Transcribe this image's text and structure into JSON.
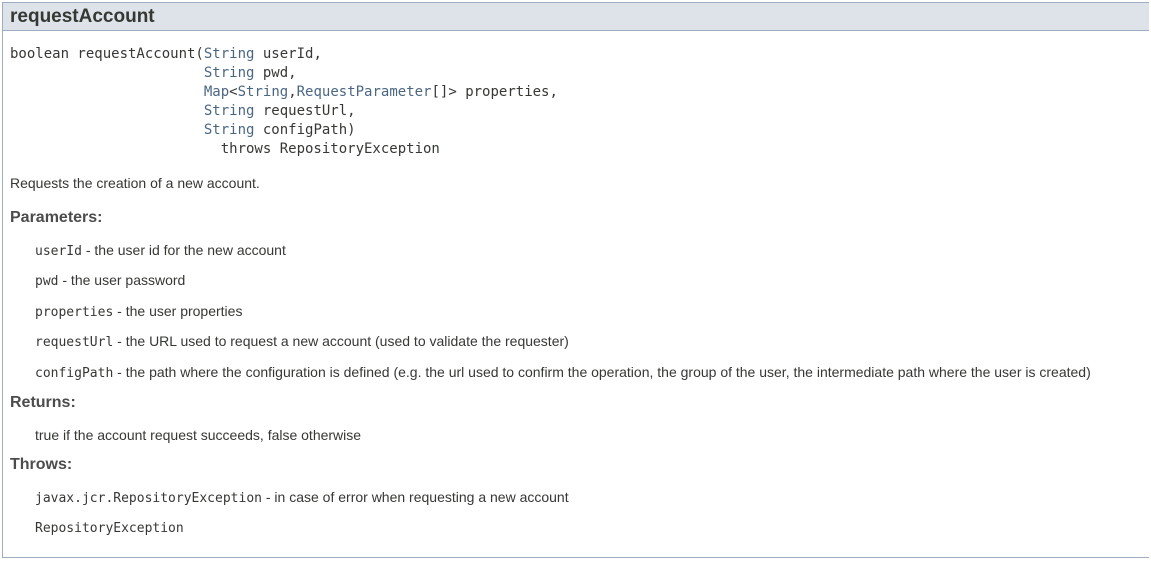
{
  "method_name": "requestAccount",
  "signature": {
    "line1": {
      "prefix": "boolean requestAccount(",
      "type": "String",
      "rest": " userId,"
    },
    "line2": {
      "type": "String",
      "rest": " pwd,"
    },
    "line3": {
      "type_map": "Map",
      "lt": "<",
      "type_string": "String",
      "comma": ",",
      "type_param": "RequestParameter",
      "rest": "[]> properties,"
    },
    "line4": {
      "type": "String",
      "rest": " requestUrl,"
    },
    "line5": {
      "type": "String",
      "rest": " configPath)"
    },
    "line6": {
      "throws": "throws RepositoryException"
    }
  },
  "description": "Requests the creation of a new account.",
  "parameters_label": "Parameters:",
  "parameters": [
    {
      "name": "userId",
      "desc": " - the user id for the new account"
    },
    {
      "name": "pwd",
      "desc": " - the user password"
    },
    {
      "name": "properties",
      "desc": " - the user properties"
    },
    {
      "name": "requestUrl",
      "desc": " - the URL used to request a new account (used to validate the requester)"
    },
    {
      "name": "configPath",
      "desc": " - the path where the configuration is defined (e.g. the url used to confirm the operation, the group of the user, the intermediate path where the user is created)"
    }
  ],
  "returns_label": "Returns:",
  "returns_text": "true if the account request succeeds, false otherwise",
  "throws_label": "Throws:",
  "throws": [
    {
      "name": "javax.jcr.RepositoryException",
      "desc": " - in case of error when requesting a new account"
    },
    {
      "name": "RepositoryException",
      "desc": ""
    }
  ],
  "colors": {
    "header_bg": "#dee3e9",
    "border": "#9eadc0",
    "type_link": "#4a6782",
    "text": "#353833"
  }
}
